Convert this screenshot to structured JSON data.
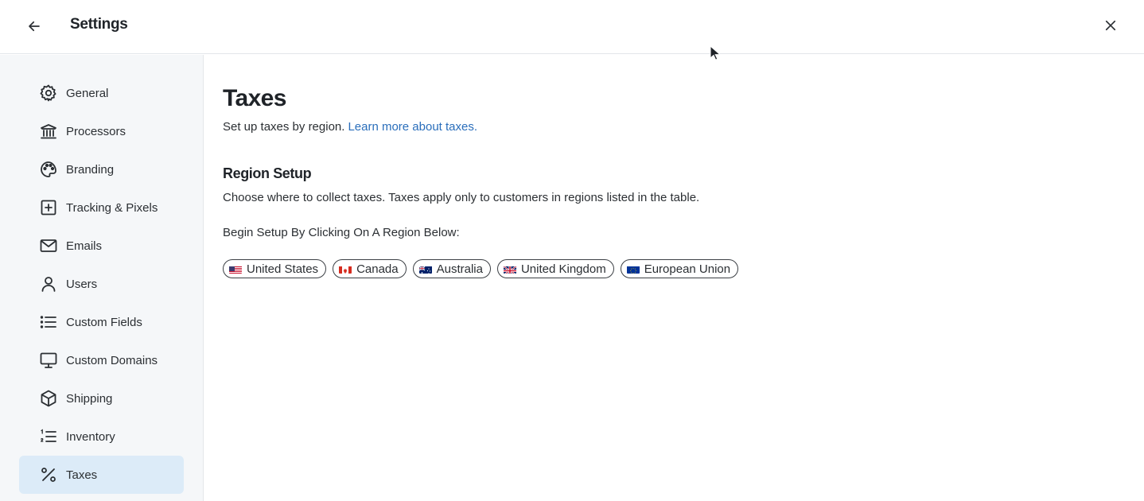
{
  "header": {
    "title": "Settings",
    "back_icon": "arrow-left-icon",
    "close_icon": "close-icon"
  },
  "sidebar": {
    "items": [
      {
        "label": "General",
        "icon": "gear-icon",
        "active": false
      },
      {
        "label": "Processors",
        "icon": "bank-icon",
        "active": false
      },
      {
        "label": "Branding",
        "icon": "palette-icon",
        "active": false
      },
      {
        "label": "Tracking & Pixels",
        "icon": "plus-square-icon",
        "active": false
      },
      {
        "label": "Emails",
        "icon": "mail-icon",
        "active": false
      },
      {
        "label": "Users",
        "icon": "user-icon",
        "active": false
      },
      {
        "label": "Custom Fields",
        "icon": "list-icon",
        "active": false
      },
      {
        "label": "Custom Domains",
        "icon": "monitor-icon",
        "active": false
      },
      {
        "label": "Shipping",
        "icon": "box-icon",
        "active": false
      },
      {
        "label": "Inventory",
        "icon": "numbered-list-icon",
        "active": false
      },
      {
        "label": "Taxes",
        "icon": "percent-icon",
        "active": true
      }
    ]
  },
  "main": {
    "title": "Taxes",
    "subtitle": "Set up taxes by region.",
    "learn_more": "Learn more about taxes.",
    "section_title": "Region Setup",
    "section_desc": "Choose where to collect taxes. Taxes apply only to customers in regions listed in the table.",
    "prompt": "Begin Setup By Clicking On A Region Below:",
    "regions": [
      {
        "label": "United States",
        "flag": "us-flag-icon"
      },
      {
        "label": "Canada",
        "flag": "canada-flag-icon"
      },
      {
        "label": "Australia",
        "flag": "australia-flag-icon"
      },
      {
        "label": "United Kingdom",
        "flag": "uk-flag-icon"
      },
      {
        "label": "European Union",
        "flag": "eu-flag-icon"
      }
    ]
  },
  "colors": {
    "accent_link": "#2a6ebb",
    "active_nav_bg": "#dcebf8",
    "sidebar_bg": "#f5f7f9"
  }
}
